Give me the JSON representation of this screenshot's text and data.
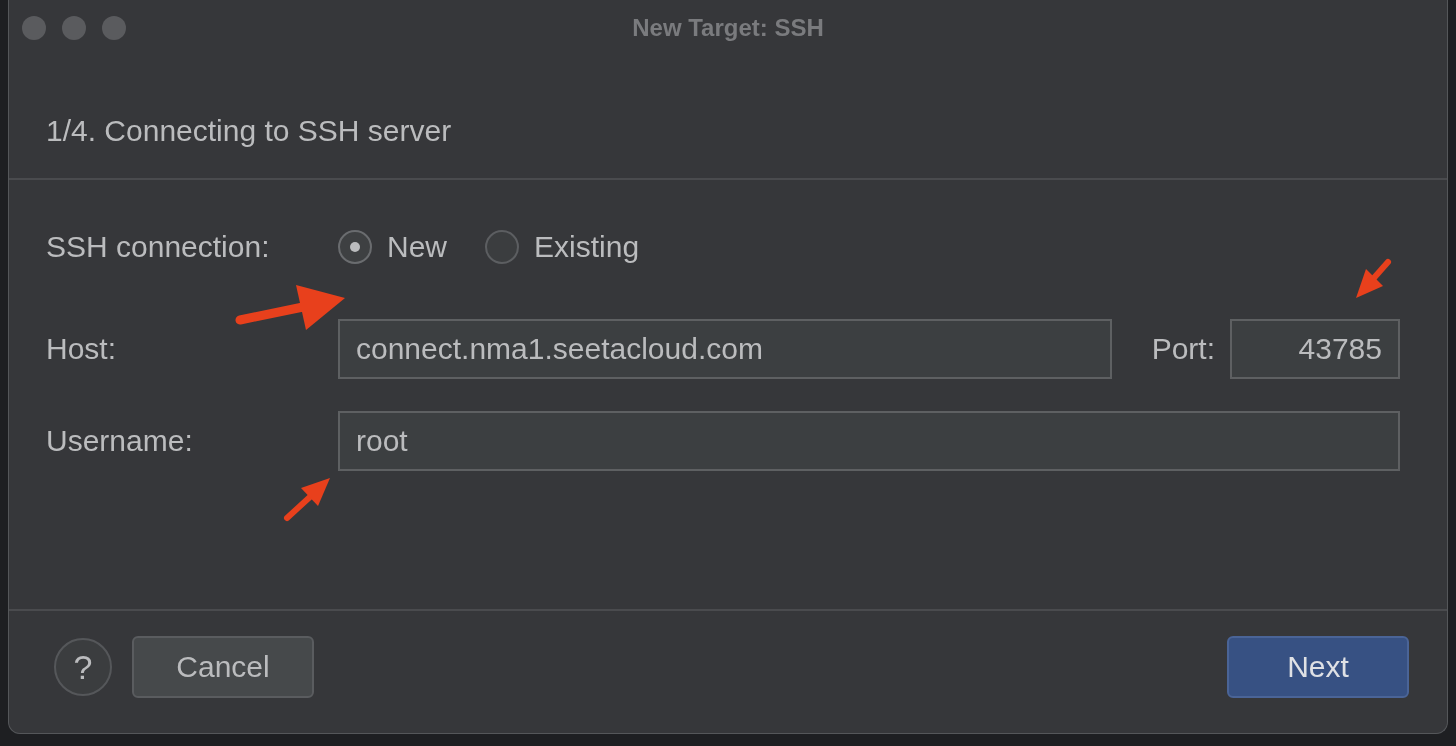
{
  "window": {
    "title": "New Target: SSH"
  },
  "step_title": "1/4. Connecting to SSH server",
  "connection": {
    "label": "SSH connection:",
    "options": [
      {
        "label": "New",
        "selected": true
      },
      {
        "label": "Existing",
        "selected": false
      }
    ]
  },
  "host": {
    "label": "Host:",
    "value": "connect.nma1.seetacloud.com"
  },
  "port": {
    "label": "Port:",
    "value": "43785"
  },
  "username": {
    "label": "Username:",
    "value": "root"
  },
  "buttons": {
    "help": "?",
    "cancel": "Cancel",
    "next": "Next"
  }
}
